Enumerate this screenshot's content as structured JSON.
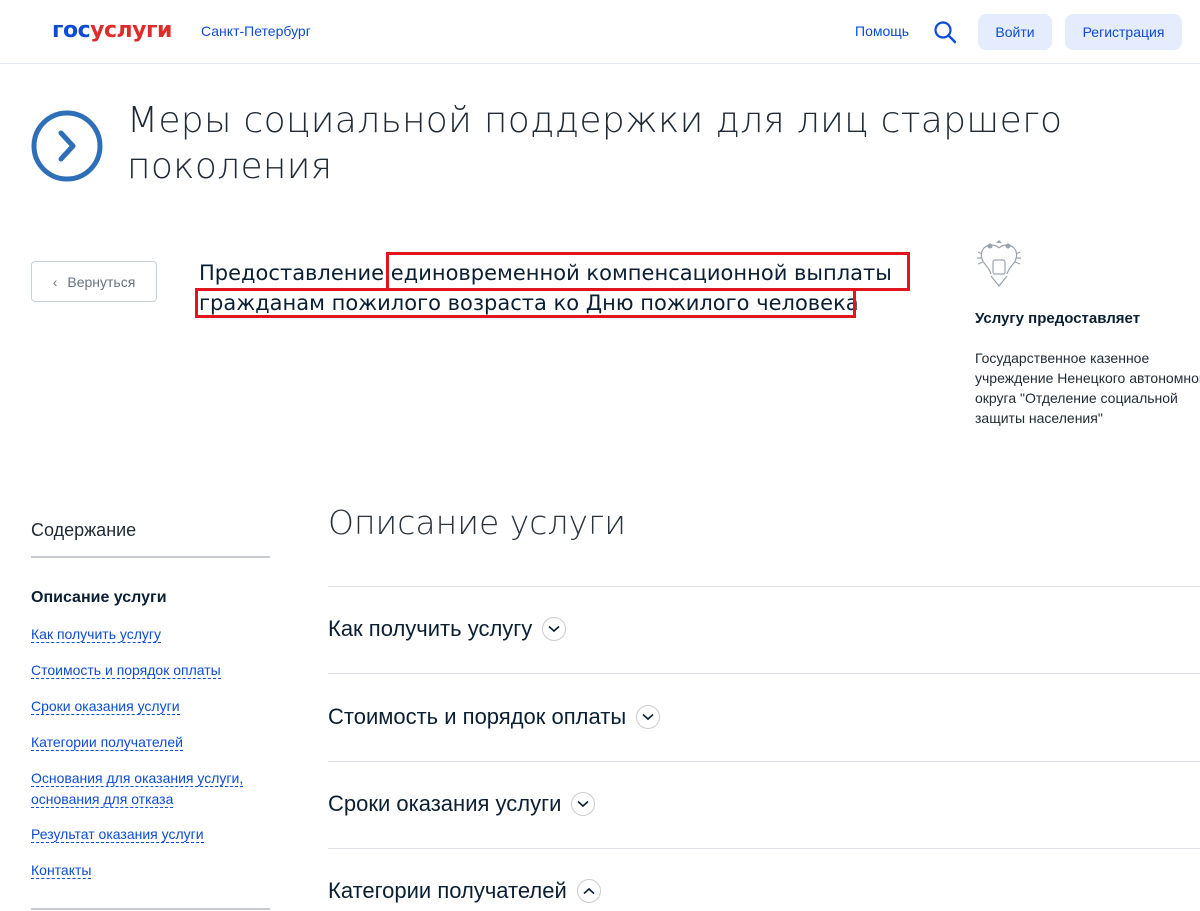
{
  "header": {
    "logo_part1": "гос",
    "logo_part2": "услуги",
    "region": "Санкт-Петербург",
    "help": "Помощь",
    "login": "Войти",
    "register": "Регистрация"
  },
  "page": {
    "title": "Меры социальной поддержки для лиц старшего поколения",
    "back_label": "Вернуться",
    "service_prefix": "Предоставление ",
    "service_highlight1": "единовременной компенсационной выплаты",
    "service_highlight2": "гражданам пожилого возраста ко Дню пожилого человека"
  },
  "provider": {
    "title": "Услугу предоставляет",
    "name": "Государственное казенное учреждение Ненецкого автономного округа \"Отделение социальной защиты населения\""
  },
  "toc": {
    "title": "Содержание",
    "active": "Описание услуги",
    "links": [
      "Как получить услугу",
      "Стоимость и порядок оплаты",
      "Сроки оказания услуги",
      "Категории получателей",
      "Основания для оказания услуги,",
      "основания для отказа",
      "Результат оказания услуги",
      "Контакты"
    ]
  },
  "main": {
    "section_title": "Описание услуги",
    "accordion": [
      "Как получить услугу",
      "Стоимость и порядок оплаты",
      "Сроки оказания услуги",
      "Категории получателей"
    ]
  },
  "colors": {
    "brand_blue": "#0d4cd3",
    "brand_red": "#e12b2b",
    "highlight_red": "#e1151c",
    "icon_blue": "#2e6fb7"
  }
}
